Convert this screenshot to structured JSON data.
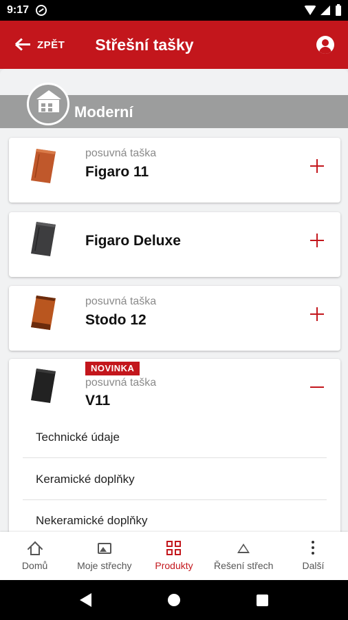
{
  "status": {
    "time": "9:17"
  },
  "appbar": {
    "back_label": "ZPĚT",
    "title": "Střešní tašky"
  },
  "section": {
    "title": "Moderní"
  },
  "products": [
    {
      "subtitle": "posuvná taška",
      "name": "Figaro 11",
      "tile_color": "#c0582b"
    },
    {
      "subtitle": "",
      "name": "Figaro Deluxe",
      "tile_color": "#3d3d3f"
    },
    {
      "subtitle": "posuvná taška",
      "name": "Stodo 12",
      "tile_color": "#b9561f"
    },
    {
      "badge": "NOVINKA",
      "subtitle": "posuvná taška",
      "name": "V11",
      "tile_color": "#222222",
      "items": [
        "Technické údaje",
        "Keramické doplňky",
        "Nekeramické doplňky"
      ]
    }
  ],
  "bottom_nav": [
    {
      "label": "Domů",
      "icon": "home-icon"
    },
    {
      "label": "Moje střechy",
      "icon": "image-icon"
    },
    {
      "label": "Produkty",
      "icon": "grid-icon",
      "active": true
    },
    {
      "label": "Řešení střech",
      "icon": "triangle-icon"
    },
    {
      "label": "Další",
      "icon": "more-icon"
    }
  ],
  "colors": {
    "brand": "#c3161c",
    "section_header": "#9c9d9d"
  }
}
